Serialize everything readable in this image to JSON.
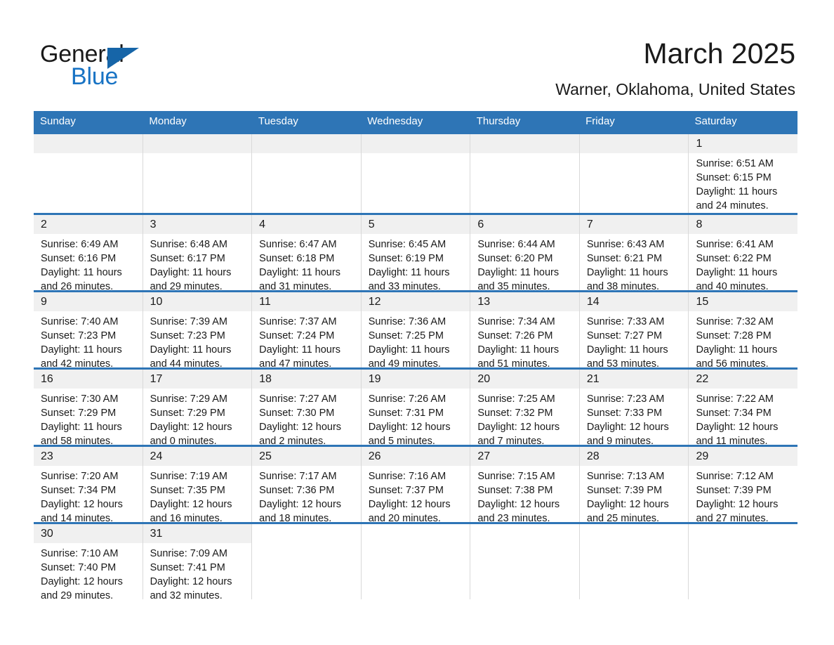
{
  "logo": {
    "word_one": "General",
    "word_two": "Blue",
    "triangle_color": "#1665a8",
    "blue_color": "#1873c4"
  },
  "header": {
    "title": "March 2025",
    "subtitle": "Warner, Oklahoma, United States"
  },
  "theme": {
    "header_blue": "#2e75b6",
    "daynum_gray": "#f0f0f0",
    "cell_border": "#d9d9d9"
  },
  "weekdays": [
    "Sunday",
    "Monday",
    "Tuesday",
    "Wednesday",
    "Thursday",
    "Friday",
    "Saturday"
  ],
  "weeks": [
    [
      {
        "day": "",
        "sunrise": "",
        "sunset": "",
        "daylight_line1": "",
        "daylight_line2": "",
        "blank": true
      },
      {
        "day": "",
        "sunrise": "",
        "sunset": "",
        "daylight_line1": "",
        "daylight_line2": "",
        "blank": true
      },
      {
        "day": "",
        "sunrise": "",
        "sunset": "",
        "daylight_line1": "",
        "daylight_line2": "",
        "blank": true
      },
      {
        "day": "",
        "sunrise": "",
        "sunset": "",
        "daylight_line1": "",
        "daylight_line2": "",
        "blank": true
      },
      {
        "day": "",
        "sunrise": "",
        "sunset": "",
        "daylight_line1": "",
        "daylight_line2": "",
        "blank": true
      },
      {
        "day": "",
        "sunrise": "",
        "sunset": "",
        "daylight_line1": "",
        "daylight_line2": "",
        "blank": true
      },
      {
        "day": "1",
        "sunrise": "Sunrise: 6:51 AM",
        "sunset": "Sunset: 6:15 PM",
        "daylight_line1": "Daylight: 11 hours",
        "daylight_line2": "and 24 minutes."
      }
    ],
    [
      {
        "day": "2",
        "sunrise": "Sunrise: 6:49 AM",
        "sunset": "Sunset: 6:16 PM",
        "daylight_line1": "Daylight: 11 hours",
        "daylight_line2": "and 26 minutes."
      },
      {
        "day": "3",
        "sunrise": "Sunrise: 6:48 AM",
        "sunset": "Sunset: 6:17 PM",
        "daylight_line1": "Daylight: 11 hours",
        "daylight_line2": "and 29 minutes."
      },
      {
        "day": "4",
        "sunrise": "Sunrise: 6:47 AM",
        "sunset": "Sunset: 6:18 PM",
        "daylight_line1": "Daylight: 11 hours",
        "daylight_line2": "and 31 minutes."
      },
      {
        "day": "5",
        "sunrise": "Sunrise: 6:45 AM",
        "sunset": "Sunset: 6:19 PM",
        "daylight_line1": "Daylight: 11 hours",
        "daylight_line2": "and 33 minutes."
      },
      {
        "day": "6",
        "sunrise": "Sunrise: 6:44 AM",
        "sunset": "Sunset: 6:20 PM",
        "daylight_line1": "Daylight: 11 hours",
        "daylight_line2": "and 35 minutes."
      },
      {
        "day": "7",
        "sunrise": "Sunrise: 6:43 AM",
        "sunset": "Sunset: 6:21 PM",
        "daylight_line1": "Daylight: 11 hours",
        "daylight_line2": "and 38 minutes."
      },
      {
        "day": "8",
        "sunrise": "Sunrise: 6:41 AM",
        "sunset": "Sunset: 6:22 PM",
        "daylight_line1": "Daylight: 11 hours",
        "daylight_line2": "and 40 minutes."
      }
    ],
    [
      {
        "day": "9",
        "sunrise": "Sunrise: 7:40 AM",
        "sunset": "Sunset: 7:23 PM",
        "daylight_line1": "Daylight: 11 hours",
        "daylight_line2": "and 42 minutes."
      },
      {
        "day": "10",
        "sunrise": "Sunrise: 7:39 AM",
        "sunset": "Sunset: 7:23 PM",
        "daylight_line1": "Daylight: 11 hours",
        "daylight_line2": "and 44 minutes."
      },
      {
        "day": "11",
        "sunrise": "Sunrise: 7:37 AM",
        "sunset": "Sunset: 7:24 PM",
        "daylight_line1": "Daylight: 11 hours",
        "daylight_line2": "and 47 minutes."
      },
      {
        "day": "12",
        "sunrise": "Sunrise: 7:36 AM",
        "sunset": "Sunset: 7:25 PM",
        "daylight_line1": "Daylight: 11 hours",
        "daylight_line2": "and 49 minutes."
      },
      {
        "day": "13",
        "sunrise": "Sunrise: 7:34 AM",
        "sunset": "Sunset: 7:26 PM",
        "daylight_line1": "Daylight: 11 hours",
        "daylight_line2": "and 51 minutes."
      },
      {
        "day": "14",
        "sunrise": "Sunrise: 7:33 AM",
        "sunset": "Sunset: 7:27 PM",
        "daylight_line1": "Daylight: 11 hours",
        "daylight_line2": "and 53 minutes."
      },
      {
        "day": "15",
        "sunrise": "Sunrise: 7:32 AM",
        "sunset": "Sunset: 7:28 PM",
        "daylight_line1": "Daylight: 11 hours",
        "daylight_line2": "and 56 minutes."
      }
    ],
    [
      {
        "day": "16",
        "sunrise": "Sunrise: 7:30 AM",
        "sunset": "Sunset: 7:29 PM",
        "daylight_line1": "Daylight: 11 hours",
        "daylight_line2": "and 58 minutes."
      },
      {
        "day": "17",
        "sunrise": "Sunrise: 7:29 AM",
        "sunset": "Sunset: 7:29 PM",
        "daylight_line1": "Daylight: 12 hours",
        "daylight_line2": "and 0 minutes."
      },
      {
        "day": "18",
        "sunrise": "Sunrise: 7:27 AM",
        "sunset": "Sunset: 7:30 PM",
        "daylight_line1": "Daylight: 12 hours",
        "daylight_line2": "and 2 minutes."
      },
      {
        "day": "19",
        "sunrise": "Sunrise: 7:26 AM",
        "sunset": "Sunset: 7:31 PM",
        "daylight_line1": "Daylight: 12 hours",
        "daylight_line2": "and 5 minutes."
      },
      {
        "day": "20",
        "sunrise": "Sunrise: 7:25 AM",
        "sunset": "Sunset: 7:32 PM",
        "daylight_line1": "Daylight: 12 hours",
        "daylight_line2": "and 7 minutes."
      },
      {
        "day": "21",
        "sunrise": "Sunrise: 7:23 AM",
        "sunset": "Sunset: 7:33 PM",
        "daylight_line1": "Daylight: 12 hours",
        "daylight_line2": "and 9 minutes."
      },
      {
        "day": "22",
        "sunrise": "Sunrise: 7:22 AM",
        "sunset": "Sunset: 7:34 PM",
        "daylight_line1": "Daylight: 12 hours",
        "daylight_line2": "and 11 minutes."
      }
    ],
    [
      {
        "day": "23",
        "sunrise": "Sunrise: 7:20 AM",
        "sunset": "Sunset: 7:34 PM",
        "daylight_line1": "Daylight: 12 hours",
        "daylight_line2": "and 14 minutes."
      },
      {
        "day": "24",
        "sunrise": "Sunrise: 7:19 AM",
        "sunset": "Sunset: 7:35 PM",
        "daylight_line1": "Daylight: 12 hours",
        "daylight_line2": "and 16 minutes."
      },
      {
        "day": "25",
        "sunrise": "Sunrise: 7:17 AM",
        "sunset": "Sunset: 7:36 PM",
        "daylight_line1": "Daylight: 12 hours",
        "daylight_line2": "and 18 minutes."
      },
      {
        "day": "26",
        "sunrise": "Sunrise: 7:16 AM",
        "sunset": "Sunset: 7:37 PM",
        "daylight_line1": "Daylight: 12 hours",
        "daylight_line2": "and 20 minutes."
      },
      {
        "day": "27",
        "sunrise": "Sunrise: 7:15 AM",
        "sunset": "Sunset: 7:38 PM",
        "daylight_line1": "Daylight: 12 hours",
        "daylight_line2": "and 23 minutes."
      },
      {
        "day": "28",
        "sunrise": "Sunrise: 7:13 AM",
        "sunset": "Sunset: 7:39 PM",
        "daylight_line1": "Daylight: 12 hours",
        "daylight_line2": "and 25 minutes."
      },
      {
        "day": "29",
        "sunrise": "Sunrise: 7:12 AM",
        "sunset": "Sunset: 7:39 PM",
        "daylight_line1": "Daylight: 12 hours",
        "daylight_line2": "and 27 minutes."
      }
    ],
    [
      {
        "day": "30",
        "sunrise": "Sunrise: 7:10 AM",
        "sunset": "Sunset: 7:40 PM",
        "daylight_line1": "Daylight: 12 hours",
        "daylight_line2": "and 29 minutes."
      },
      {
        "day": "31",
        "sunrise": "Sunrise: 7:09 AM",
        "sunset": "Sunset: 7:41 PM",
        "daylight_line1": "Daylight: 12 hours",
        "daylight_line2": "and 32 minutes."
      },
      {
        "day": "",
        "sunrise": "",
        "sunset": "",
        "daylight_line1": "",
        "daylight_line2": "",
        "blank": true
      },
      {
        "day": "",
        "sunrise": "",
        "sunset": "",
        "daylight_line1": "",
        "daylight_line2": "",
        "blank": true
      },
      {
        "day": "",
        "sunrise": "",
        "sunset": "",
        "daylight_line1": "",
        "daylight_line2": "",
        "blank": true
      },
      {
        "day": "",
        "sunrise": "",
        "sunset": "",
        "daylight_line1": "",
        "daylight_line2": "",
        "blank": true
      },
      {
        "day": "",
        "sunrise": "",
        "sunset": "",
        "daylight_line1": "",
        "daylight_line2": "",
        "blank": true
      }
    ]
  ]
}
